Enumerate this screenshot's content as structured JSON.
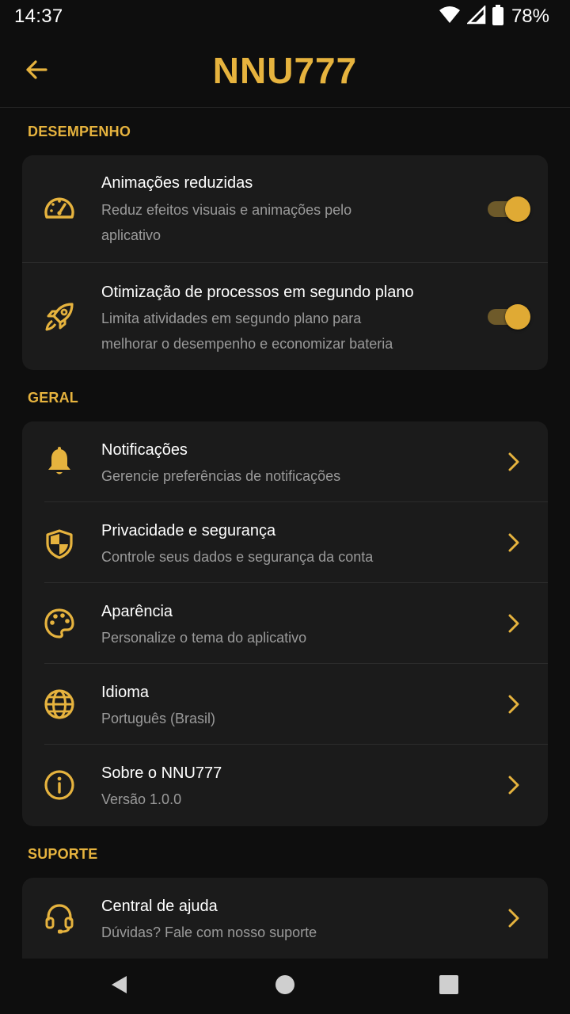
{
  "status_bar": {
    "time": "14:37",
    "battery_percent": "78%",
    "icons": [
      "wifi-icon",
      "signal-icon",
      "battery-icon"
    ]
  },
  "header": {
    "title": "NNU777",
    "back_icon": "arrow-left-icon"
  },
  "theme": {
    "accent": "#e6b33e",
    "background": "#0e0e0e",
    "card": "#1b1b1b",
    "secondary_text": "#9a9a9a"
  },
  "sections": {
    "performance": {
      "title": "DESEMPENHO",
      "items": [
        {
          "icon": "speedometer-icon",
          "title": "Animações reduzidas",
          "subtitle_line1": "Reduz efeitos visuais e animações pelo",
          "subtitle_line2": "aplicativo",
          "toggle_on": true
        },
        {
          "icon": "rocket-icon",
          "title": "Otimização de processos em segundo plano",
          "subtitle_line1": "Limita atividades em segundo plano para",
          "subtitle_line2": "melhorar o desempenho e economizar bateria",
          "toggle_on": true
        }
      ]
    },
    "general": {
      "title": "GERAL",
      "items": [
        {
          "icon": "bell-icon",
          "title": "Notificações",
          "subtitle": "Gerencie preferências de notificações"
        },
        {
          "icon": "shield-icon",
          "title": "Privacidade e segurança",
          "subtitle": "Controle seus dados e segurança da conta"
        },
        {
          "icon": "palette-icon",
          "title": "Aparência",
          "subtitle": "Personalize o tema do aplicativo"
        },
        {
          "icon": "globe-icon",
          "title": "Idioma",
          "subtitle": "Português (Brasil)"
        },
        {
          "icon": "info-icon",
          "title": "Sobre o NNU777",
          "subtitle": "Versão 1.0.0"
        }
      ]
    },
    "support": {
      "title": "SUPORTE",
      "items": [
        {
          "icon": "headset-icon",
          "title": "Central de ajuda",
          "subtitle": "Dúvidas? Fale com nosso suporte"
        }
      ]
    }
  },
  "nav_bar": {
    "buttons": [
      "back-triangle-icon",
      "home-circle-icon",
      "recents-square-icon"
    ]
  }
}
